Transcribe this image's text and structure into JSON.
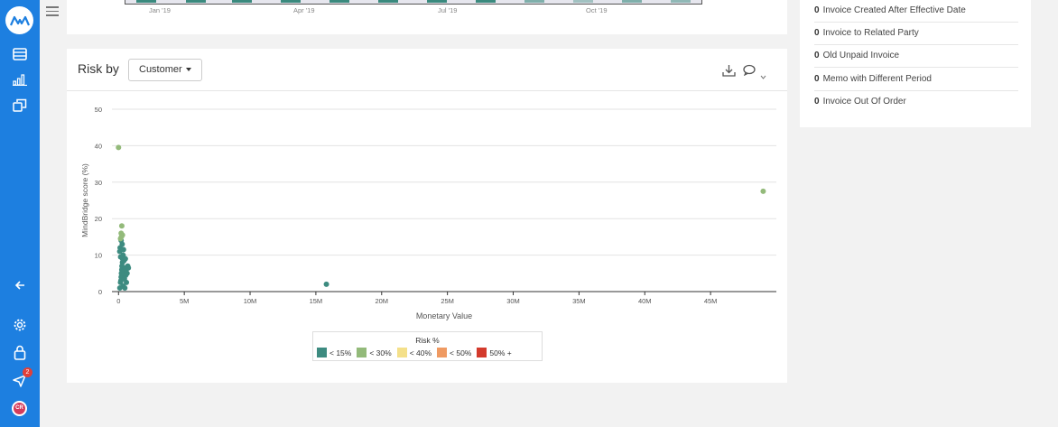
{
  "app": {
    "logo_text": "MM",
    "notification_count": "2",
    "user_initials": "CR",
    "brand_color": "#1d7fe0"
  },
  "top_chart": {
    "ticks": [
      "Jan '19",
      "Apr '19",
      "Jul '19",
      "Oct '19"
    ]
  },
  "risk_card": {
    "title": "Risk by",
    "dropdown_value": "Customer"
  },
  "right_panel": {
    "items": [
      {
        "count": "0",
        "label": "Invoice Created After Effective Date"
      },
      {
        "count": "0",
        "label": "Invoice to Related Party"
      },
      {
        "count": "0",
        "label": "Old Unpaid Invoice"
      },
      {
        "count": "0",
        "label": "Memo with Different Period"
      },
      {
        "count": "0",
        "label": "Invoice Out Of Order"
      }
    ]
  },
  "chart_data": {
    "type": "scatter",
    "xlabel": "Monetary Value",
    "ylabel": "MindBridge score (%)",
    "xlim": [
      -500000,
      50000000
    ],
    "ylim": [
      0,
      50
    ],
    "x_ticks": [
      0,
      5000000,
      10000000,
      15000000,
      20000000,
      25000000,
      30000000,
      35000000,
      40000000,
      45000000
    ],
    "x_tick_labels": [
      "0",
      "5M",
      "10M",
      "15M",
      "20M",
      "25M",
      "30M",
      "35M",
      "40M",
      "45M"
    ],
    "y_ticks": [
      0,
      10,
      20,
      30,
      40,
      50
    ],
    "y_tick_labels": [
      "0",
      "10",
      "20",
      "30",
      "40",
      "50"
    ],
    "grid": true,
    "legend_title": "Risk %",
    "legend_position": "bottom-center",
    "series": [
      {
        "name": "< 15%",
        "color": "#3d8b80",
        "points": [
          [
            15800000,
            2
          ],
          [
            100000,
            1
          ],
          [
            150000,
            2.5
          ],
          [
            200000,
            4
          ],
          [
            250000,
            6
          ],
          [
            300000,
            8
          ],
          [
            350000,
            10
          ],
          [
            120000,
            12
          ],
          [
            180000,
            3
          ],
          [
            220000,
            5
          ],
          [
            260000,
            7
          ],
          [
            310000,
            9
          ],
          [
            90000,
            11
          ],
          [
            400000,
            5.5
          ],
          [
            450000,
            3.5
          ],
          [
            500000,
            6.5
          ],
          [
            550000,
            4.5
          ],
          [
            600000,
            2.5
          ],
          [
            650000,
            5
          ],
          [
            700000,
            7
          ],
          [
            350000,
            1.5
          ],
          [
            280000,
            13
          ],
          [
            200000,
            14
          ],
          [
            160000,
            9.5
          ],
          [
            420000,
            8.5
          ],
          [
            380000,
            11.5
          ],
          [
            480000,
            1
          ],
          [
            520000,
            9
          ],
          [
            580000,
            6
          ],
          [
            750000,
            6.5
          ]
        ]
      },
      {
        "name": "< 30%",
        "color": "#93ba7a",
        "points": [
          [
            0,
            39.5
          ],
          [
            49000000,
            27.5
          ],
          [
            250000,
            18
          ],
          [
            200000,
            16
          ],
          [
            300000,
            15.5
          ],
          [
            150000,
            14.5
          ],
          [
            220000,
            15
          ]
        ]
      },
      {
        "name": "< 40%",
        "color": "#f4e08a",
        "points": []
      },
      {
        "name": "< 50%",
        "color": "#ef9a62",
        "points": []
      },
      {
        "name": "50% +",
        "color": "#d33a2c",
        "points": []
      }
    ]
  }
}
